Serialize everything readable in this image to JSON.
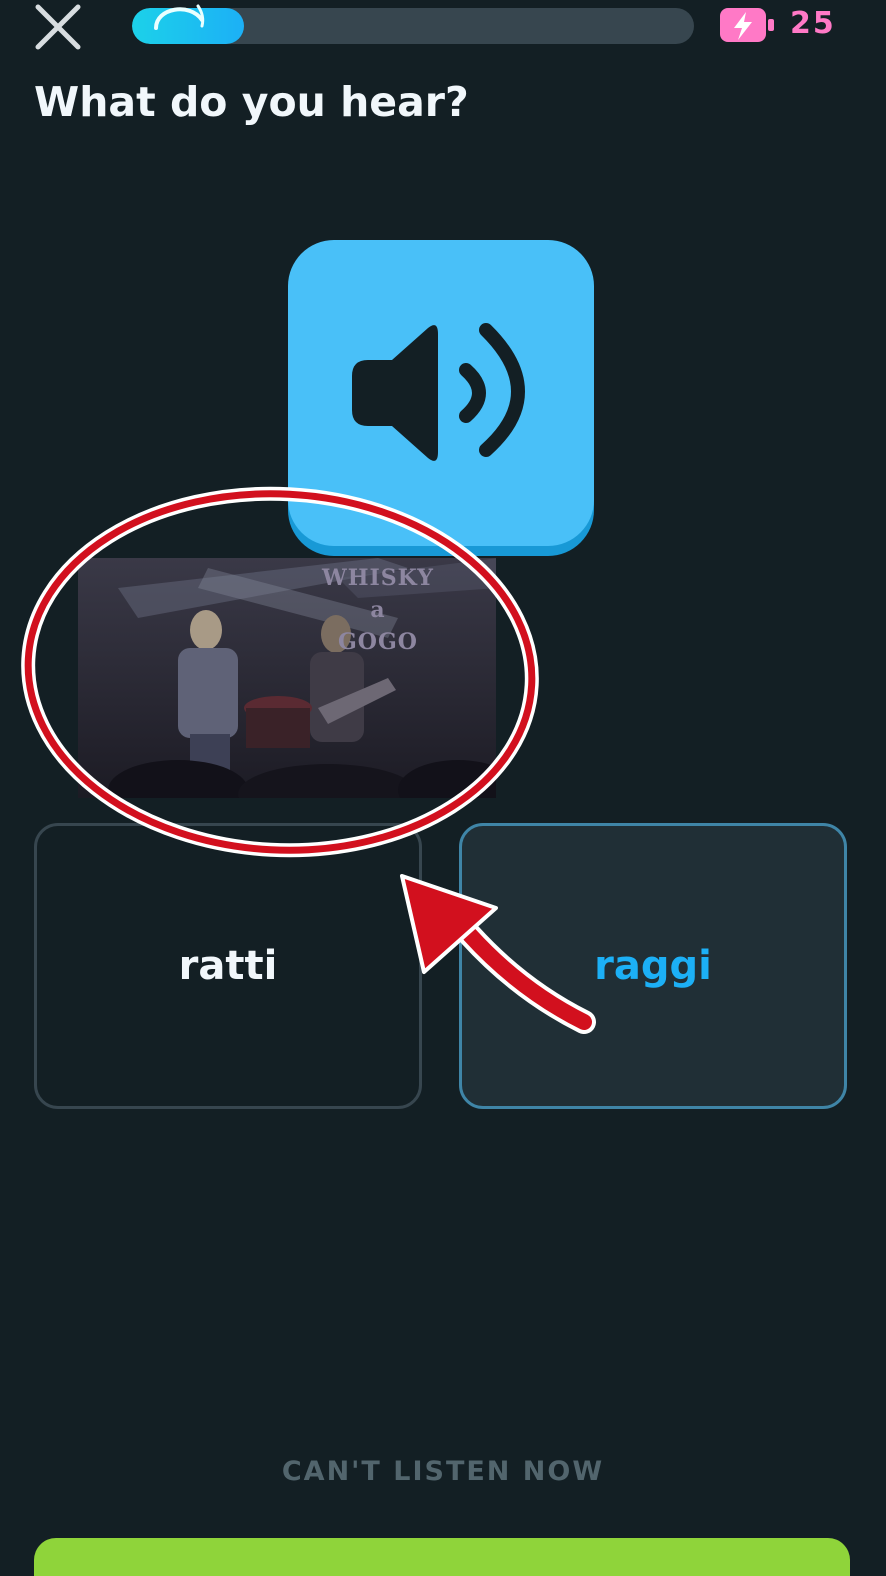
{
  "header": {
    "close_icon": "close-icon",
    "progress": 0.2,
    "energy_icon": "energy-battery-icon",
    "energy_count": "25"
  },
  "prompt": "What do you hear?",
  "audio_button_icon": "speaker-icon",
  "video_overlay": {
    "sign_text": "WHISKY\na\nGOGO"
  },
  "choices": [
    {
      "label": "ratti",
      "state": "default"
    },
    {
      "label": "raggi",
      "state": "selected"
    }
  ],
  "footer": {
    "cant_listen_label": "CAN'T LISTEN NOW"
  },
  "colors": {
    "background": "#131f24",
    "accent_blue": "#1cb0f6",
    "speaker_blue": "#49c0f8",
    "energy_pink": "#ff79c6",
    "annotation_red": "#d2101e",
    "check_green": "#8fd43a"
  }
}
